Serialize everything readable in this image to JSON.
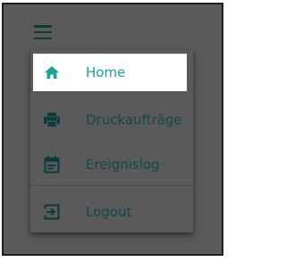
{
  "header": {
    "menu_icon": "hamburger-menu-icon"
  },
  "menu": {
    "items": [
      {
        "label": "Home",
        "icon": "home-icon",
        "active": true
      },
      {
        "label": "Druckaufträge",
        "icon": "printer-icon",
        "active": false
      },
      {
        "label": "Ereignislog",
        "icon": "calendar-icon",
        "active": false
      },
      {
        "label": "Logout",
        "icon": "logout-icon",
        "active": false
      }
    ]
  },
  "colors": {
    "accent": "#18a599",
    "text": "#11494a",
    "overlay": "#5a5a5a",
    "active_bg": "#ffffff"
  }
}
